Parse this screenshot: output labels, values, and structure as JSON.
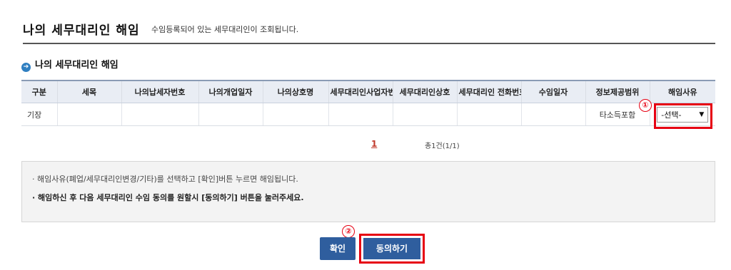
{
  "header": {
    "title": "나의 세무대리인 해임",
    "subtitle": "수임등록되어 있는 세무대리인이 조회됩니다."
  },
  "section": {
    "title": "나의 세무대리인 해임"
  },
  "table": {
    "columns": [
      "구분",
      "세목",
      "나의납세자번호",
      "나의개업일자",
      "나의상호명",
      "세무대리인사업자번호",
      "세무대리인상호",
      "세무대리인 전화번호",
      "수임일자",
      "정보제공범위",
      "해임사유"
    ],
    "row": [
      "기장",
      "",
      "",
      "",
      "",
      "",
      "",
      "",
      "",
      "타소득포함",
      ""
    ],
    "reason_select": "-선택-"
  },
  "pager": {
    "current": "1",
    "total": "총1건(1/1)"
  },
  "notice": {
    "line1": "· 해임사유(폐업/세무대리인변경/기타)를 선택하고 [확인]버튼 누르면 해임됩니다.",
    "line2": "· 해임하신 후 다음 세무대리인 수임 동의를 원할시 [동의하기] 버튼을 눌러주세요."
  },
  "buttons": {
    "confirm": "확인",
    "agree": "동의하기"
  },
  "markers": {
    "one": "①",
    "two": "②"
  },
  "colors": {
    "accent_red": "#e60012",
    "button_blue": "#2f5e9e",
    "header_bg": "#e9edf4"
  }
}
